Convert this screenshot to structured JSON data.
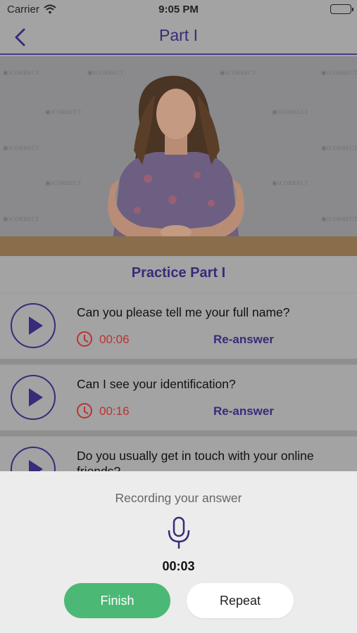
{
  "status_bar": {
    "carrier": "Carrier",
    "time": "9:05 PM",
    "icons": [
      "wifi-icon",
      "battery-icon"
    ]
  },
  "nav": {
    "back_icon": "chevron-left-icon",
    "title": "Part I"
  },
  "video": {
    "watermark": "ICORRECT"
  },
  "section": {
    "title": "Practice Part I"
  },
  "questions": [
    {
      "text": "Can you please tell me your full name?",
      "duration": "00:06",
      "action": "Re-answer"
    },
    {
      "text": "Can I see your identification?",
      "duration": "00:16",
      "action": "Re-answer"
    },
    {
      "text": "Do you usually get in touch with your online friends?",
      "duration": "",
      "action": ""
    }
  ],
  "recording_sheet": {
    "label": "Recording your answer",
    "mic_icon": "microphone-icon",
    "timer": "00:03",
    "finish_label": "Finish",
    "repeat_label": "Repeat"
  },
  "colors": {
    "accent": "#3a2a7a",
    "timer_red": "#b33333",
    "finish_green": "#4cb876"
  }
}
